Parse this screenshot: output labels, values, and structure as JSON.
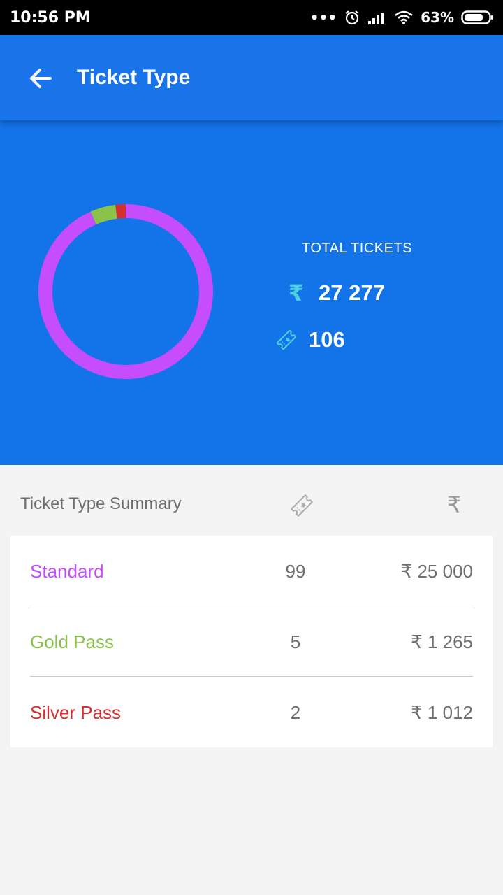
{
  "status_bar": {
    "time": "10:56 PM",
    "battery": "63%"
  },
  "app_bar": {
    "title": "Ticket Type"
  },
  "hero": {
    "total_label": "TOTAL TICKETS",
    "currency_symbol": "₹",
    "total_amount": "27 277",
    "total_count": "106"
  },
  "summary": {
    "title": "Ticket Type Summary",
    "currency_symbol": "₹",
    "rows": [
      {
        "name": "Standard",
        "count": "99",
        "amount": "25 000",
        "color": "#c64dfc"
      },
      {
        "name": "Gold Pass",
        "count": "5",
        "amount": "1 265",
        "color": "#8bc34a"
      },
      {
        "name": "Silver Pass",
        "count": "2",
        "amount": "1 012",
        "color": "#d32f2f"
      }
    ]
  },
  "chart_data": {
    "type": "pie",
    "categories": [
      "Standard",
      "Gold Pass",
      "Silver Pass"
    ],
    "values": [
      99,
      5,
      2
    ],
    "colors": [
      "#c64dfc",
      "#8bc34a",
      "#d32f2f"
    ],
    "style": "donut"
  },
  "colors": {
    "primary": "#1874e8",
    "accent_teal": "#4dd0e1"
  }
}
